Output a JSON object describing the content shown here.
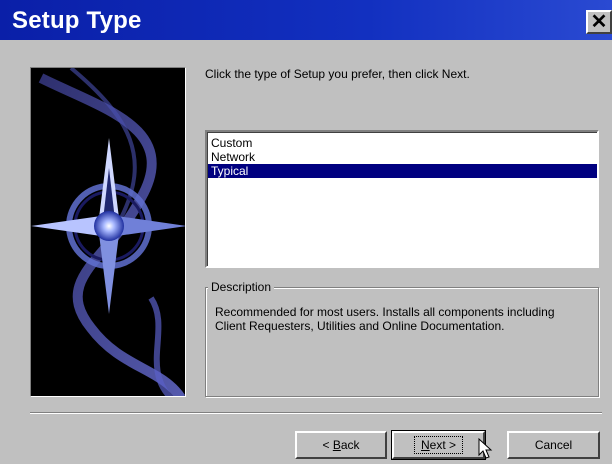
{
  "window": {
    "title": "Setup Type",
    "close_glyph": "✕"
  },
  "instruction": "Click the type of Setup you prefer, then click Next.",
  "setup_types": [
    {
      "label": "Custom",
      "selected": false
    },
    {
      "label": "Network",
      "selected": false
    },
    {
      "label": "Typical",
      "selected": true
    }
  ],
  "description": {
    "legend": "Description",
    "text": "Recommended for most users.  Installs all components including Client Requesters, Utilities and Online Documentation."
  },
  "buttons": {
    "back_mnemonic": "B",
    "back_rest": "ack",
    "back_prefix": "< ",
    "next_mnemonic": "N",
    "next_rest": "ext >",
    "cancel": "Cancel"
  },
  "colors": {
    "title_bar": "#0a1fa8",
    "selection": "#000080",
    "face": "#c0c0c0"
  },
  "icons": {
    "close": "close-icon",
    "cursor": "mouse-pointer-icon",
    "art": "compass-star-artwork"
  }
}
